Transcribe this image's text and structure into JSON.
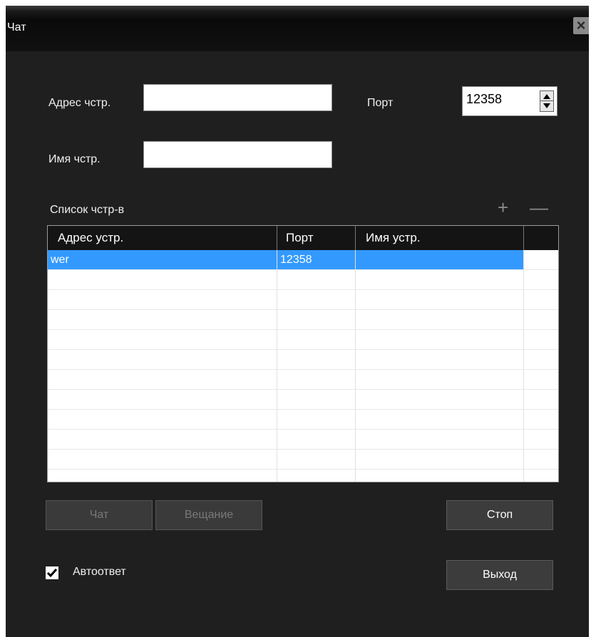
{
  "window": {
    "title": "Чат",
    "close_icon": "×"
  },
  "form": {
    "address_label": "Адрес чстр.",
    "address_value": "",
    "port_label": "Порт",
    "port_value": "12358",
    "name_label": "Имя чстр.",
    "name_value": ""
  },
  "list": {
    "title": "Список чстр-в",
    "add_label": "+",
    "remove_label": "—",
    "columns": [
      "Адрес устр.",
      "Порт",
      "Имя устр."
    ],
    "rows": [
      {
        "address": "wer",
        "port": "12358",
        "name": ""
      }
    ]
  },
  "buttons": {
    "chat": "Чат",
    "broadcast": "Вещание",
    "stop": "Стоп",
    "exit": "Выход"
  },
  "autoreply": {
    "label": "Автоответ",
    "checked": true
  }
}
